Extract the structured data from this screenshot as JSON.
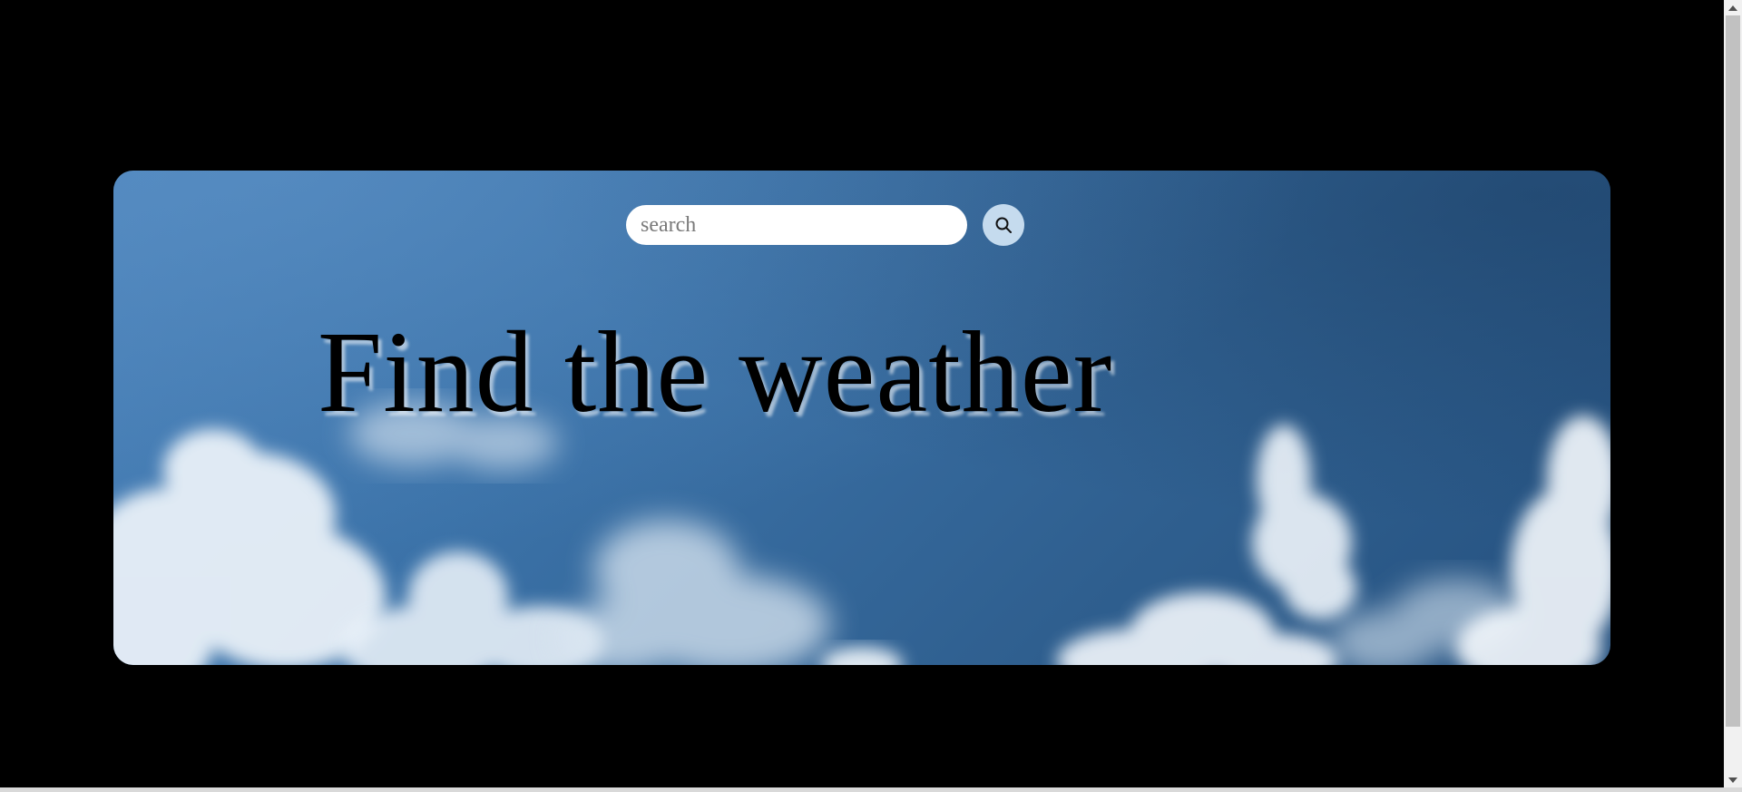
{
  "search": {
    "placeholder": "search",
    "button_icon": "search-icon"
  },
  "hero": {
    "headline": "Find the weather",
    "background": "sky-with-clouds"
  },
  "colors": {
    "page_background": "#000000",
    "sky_top": "#4a82ba",
    "sky_bottom": "#25517f",
    "search_button_bg": "#c5dbee",
    "input_bg": "#ffffff"
  },
  "scrollbar": {
    "up_icon": "scroll-up-arrow-icon",
    "down_icon": "scroll-down-arrow-icon"
  }
}
